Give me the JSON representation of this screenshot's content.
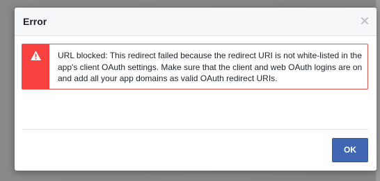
{
  "dialog": {
    "title": "Error",
    "close_icon": "close-icon",
    "error": {
      "icon": "warning-icon",
      "icon_bg_color": "#f94140",
      "border_color": "#e25151",
      "message": "URL blocked: This redirect failed because the redirect URI is not white-listed in the app's client OAuth settings. Make sure that the client and web OAuth logins are on and add all your app domains as valid OAuth redirect URIs."
    },
    "ok_label": "OK",
    "ok_color": "#4267b2"
  }
}
